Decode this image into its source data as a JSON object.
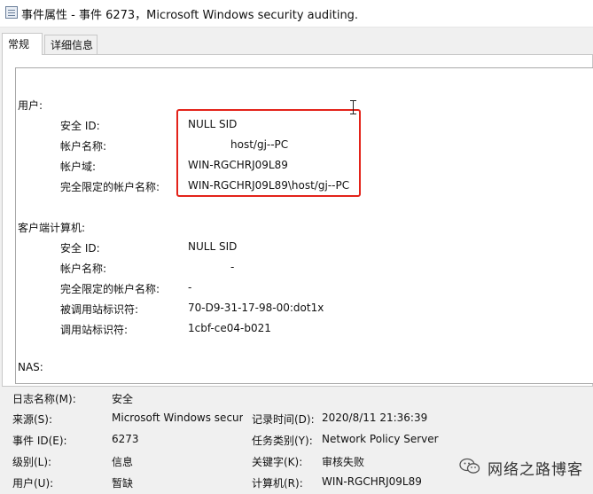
{
  "window": {
    "title": "事件属性 - 事件 6273，Microsoft Windows security auditing."
  },
  "tabs": [
    {
      "label": "常规",
      "active": true
    },
    {
      "label": "详细信息",
      "active": false
    }
  ],
  "description": {
    "user_section": {
      "title": "用户:",
      "fields": [
        {
          "label": "安全 ID:",
          "value": "NULL SID"
        },
        {
          "label": "帐户名称:",
          "value": "host/gj--PC"
        },
        {
          "label": "帐户域:",
          "value": "WIN-RGCHRJ09L89"
        },
        {
          "label": "完全限定的帐户名称:",
          "value": "WIN-RGCHRJ09L89\\host/gj--PC"
        }
      ]
    },
    "client_section": {
      "title": "客户端计算机:",
      "fields": [
        {
          "label": "安全 ID:",
          "value": "NULL SID"
        },
        {
          "label": "帐户名称:",
          "value": "-"
        },
        {
          "label": "完全限定的帐户名称:",
          "value": "-"
        },
        {
          "label": "被调用站标识符:",
          "value": "70-D9-31-17-98-00:dot1x"
        },
        {
          "label": "调用站标识符:",
          "value": "1cbf-ce04-b021"
        }
      ]
    },
    "nas_section": {
      "title": "NAS:"
    },
    "highlight_color": "#e3231a"
  },
  "info": {
    "log_name": {
      "label": "日志名称(M):",
      "value": "安全"
    },
    "source": {
      "label": "来源(S):",
      "value": "Microsoft Windows security auditing."
    },
    "logged": {
      "label": "记录时间(D):",
      "value": "2020/8/11 21:36:39"
    },
    "event_id": {
      "label": "事件 ID(E):",
      "value": "6273"
    },
    "task_category": {
      "label": "任务类别(Y):",
      "value": "Network Policy Server"
    },
    "level": {
      "label": "级别(L):",
      "value": "信息"
    },
    "keywords": {
      "label": "关键字(K):",
      "value": "审核失败"
    },
    "user": {
      "label": "用户(U):",
      "value": "暂缺"
    },
    "computer": {
      "label": "计算机(R):",
      "value": "WIN-RGCHRJ09L89"
    }
  },
  "watermark": {
    "text": "网络之路博客",
    "icon": "wechat-icon"
  }
}
